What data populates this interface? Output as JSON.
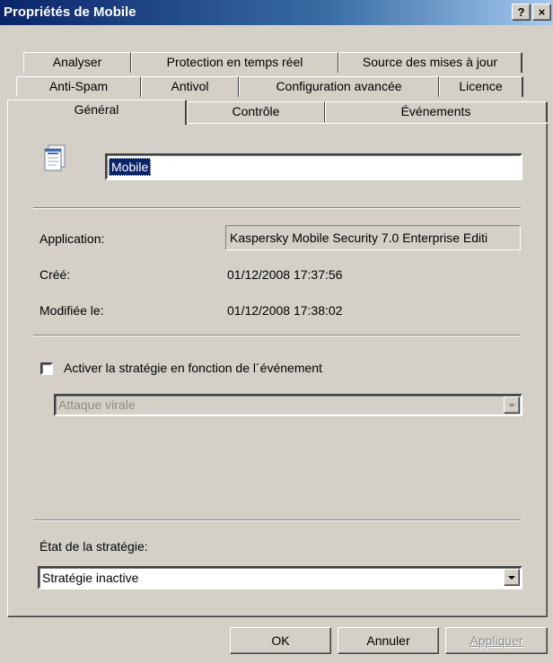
{
  "window": {
    "title": "Propriétés de Mobile",
    "help_label": "?",
    "close_label": "×"
  },
  "tabs": {
    "row1": [
      "Analyser",
      "Protection en temps réel",
      "Source des mises à jour"
    ],
    "row2": [
      "Anti-Spam",
      "Antivol",
      "Configuration avancée",
      "Licence"
    ],
    "row3": [
      "Général",
      "Contrôle",
      "Événements"
    ]
  },
  "general": {
    "name_value": "Mobile",
    "application_label": "Application:",
    "application_value": "Kaspersky Mobile Security 7.0 Enterprise Editi",
    "created_label": "Créé:",
    "created_value": "01/12/2008 17:37:56",
    "modified_label": "Modifiée le:",
    "modified_value": "01/12/2008 17:38:02",
    "event_checkbox_label": "Activer la stratégie en fonction de l´événement",
    "event_select_value": "Attaque virale",
    "state_label": "État de la stratégie:",
    "state_select_value": "Stratégie inactive"
  },
  "buttons": {
    "ok": "OK",
    "cancel": "Annuler",
    "apply": "Appliquer"
  },
  "colors": {
    "face": "#d4d0c8",
    "title_start": "#0a246a",
    "title_end": "#a6caf0",
    "selection": "#0a246a"
  }
}
